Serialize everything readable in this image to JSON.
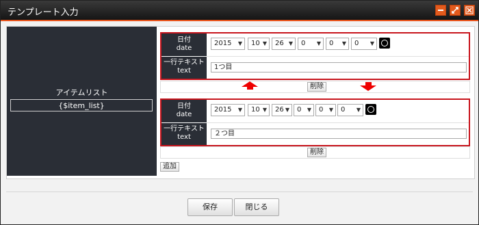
{
  "window": {
    "title": "テンプレート入力"
  },
  "left": {
    "label": "アイテムリスト",
    "field": "{$item_list}"
  },
  "items": [
    {
      "date_label": "日付\ndate",
      "text_label": "一行テキスト\ntext",
      "date": {
        "year": "2015",
        "month": "10",
        "day": "26",
        "hour": "0",
        "minute": "0",
        "second": "0"
      },
      "text_value": "1つ目",
      "delete_label": "削除"
    },
    {
      "date_label": "日付\ndate",
      "text_label": "一行テキスト\ntext",
      "date": {
        "year": "2015",
        "month": "10",
        "day": "26",
        "hour": "0",
        "minute": "0",
        "second": "0"
      },
      "text_value": "２つ目",
      "delete_label": "削除"
    }
  ],
  "add_label": "追加",
  "footer": {
    "save_label": "保存",
    "close_label": "閉じる"
  },
  "colors": {
    "title_accent": "#e8541c",
    "highlight": "#c8141c",
    "dark_panel": "#2a2e36"
  },
  "icons": {
    "minimize": "minimize-icon",
    "maximize": "maximize-icon",
    "close": "close-icon",
    "clock": "clock-icon",
    "move_up": "arrow-up-icon",
    "move_down": "arrow-down-icon"
  }
}
